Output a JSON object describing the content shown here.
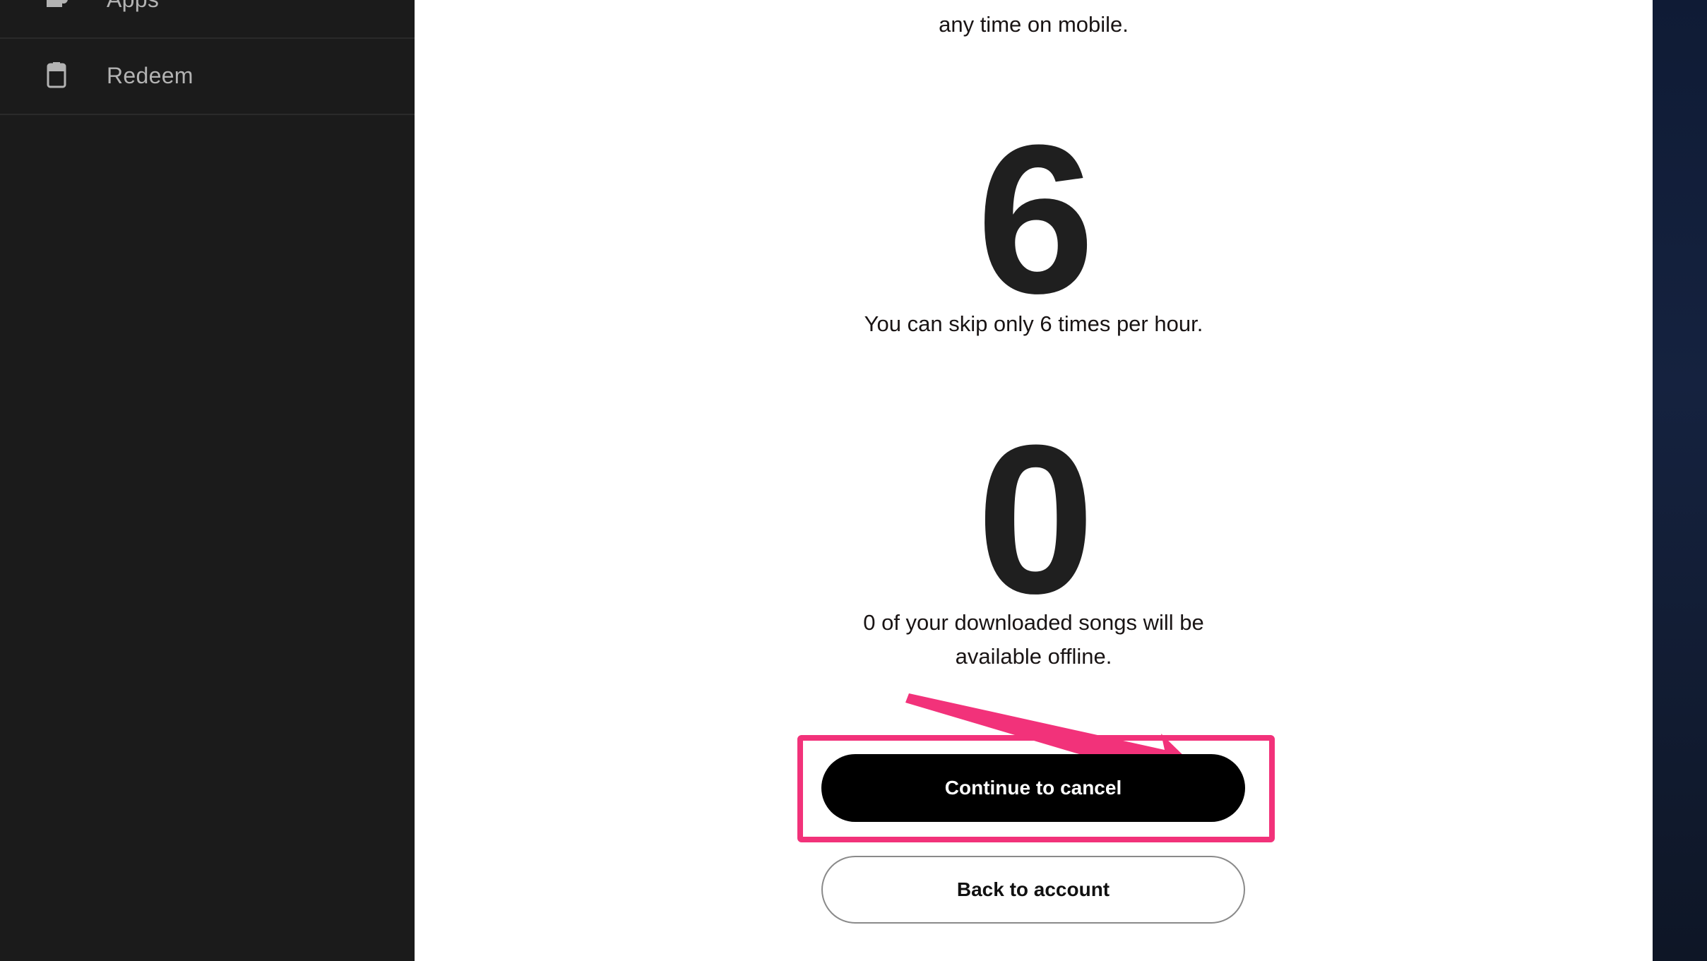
{
  "sidebar": {
    "items": [
      {
        "label": "Apps",
        "icon": "apps-icon"
      },
      {
        "label": "Redeem",
        "icon": "redeem-icon"
      }
    ]
  },
  "main": {
    "intro_text": "any time on mobile.",
    "skips": {
      "number": "6",
      "description": "You can skip only 6 times per hour."
    },
    "downloads": {
      "number": "0",
      "description_line1": "0 of your downloaded songs will be",
      "description_line2": "available offline."
    },
    "continue_button": "Continue to cancel",
    "back_button": "Back to account"
  },
  "colors": {
    "sidebar_bg": "#1b1b1b",
    "highlight": "#f2327a",
    "primary_button": "#000000"
  }
}
